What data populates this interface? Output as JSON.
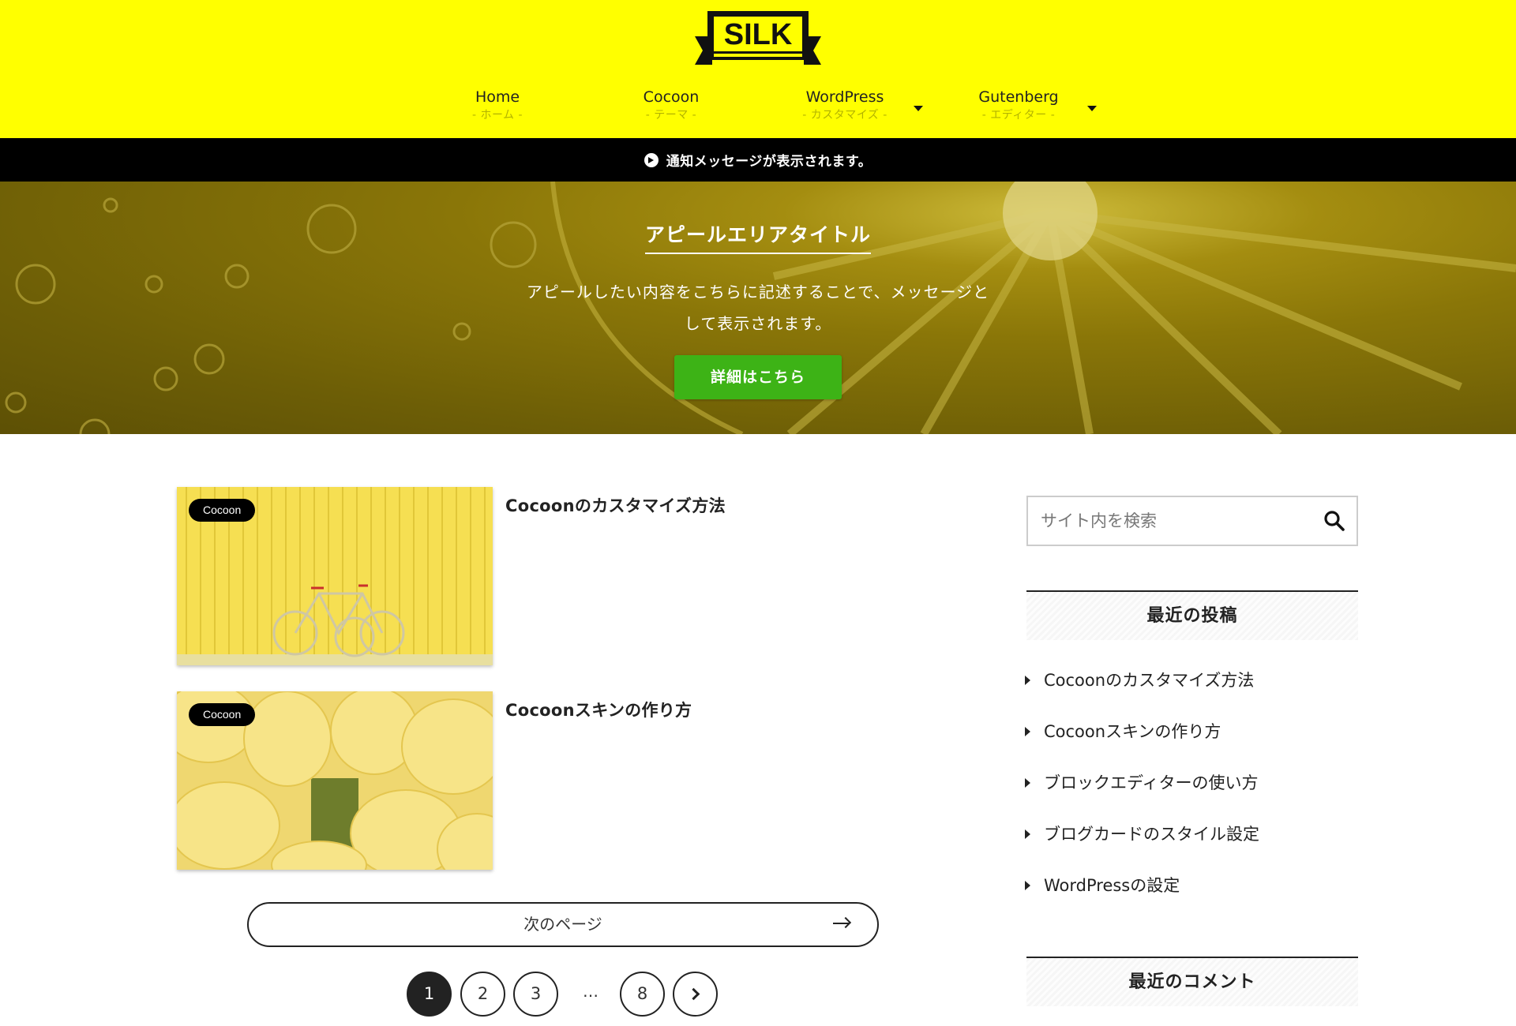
{
  "header": {
    "logo_text": "SILK",
    "nav": [
      {
        "label": "Home",
        "sub": "- ホーム -"
      },
      {
        "label": "Cocoon",
        "sub": "- テーマ -"
      },
      {
        "label": "WordPress",
        "sub": "- カスタマイズ -",
        "has_submenu": true
      },
      {
        "label": "Gutenberg",
        "sub": "- エディター -",
        "has_submenu": true
      }
    ],
    "bg_color": "#ffff00"
  },
  "notice": {
    "icon": "arrow-circle-right-icon",
    "text": "通知メッセージが表示されます。"
  },
  "appeal": {
    "title": "アピールエリアタイトル",
    "message_line1": "アピールしたい内容をこちらに記述することで、メッセージと",
    "message_line2": "して表示されます。",
    "button_label": "詳細はこちら",
    "button_color": "#3db316"
  },
  "posts": [
    {
      "category": "Cocoon",
      "title": "Cocoonのカスタマイズ方法"
    },
    {
      "category": "Cocoon",
      "title": "Cocoonスキンの作り方"
    }
  ],
  "pagination": {
    "next_page_label": "次のページ",
    "pages": [
      "1",
      "2",
      "3"
    ],
    "ellipsis": "…",
    "last_page": "8",
    "current": "1"
  },
  "sidebar": {
    "search_placeholder": "サイト内を検索",
    "recent_posts_title": "最近の投稿",
    "recent_posts": [
      "Cocoonのカスタマイズ方法",
      "Cocoonスキンの作り方",
      "ブロックエディターの使い方",
      "ブログカードのスタイル設定",
      "WordPressの設定"
    ],
    "recent_comments_title": "最近のコメント"
  }
}
